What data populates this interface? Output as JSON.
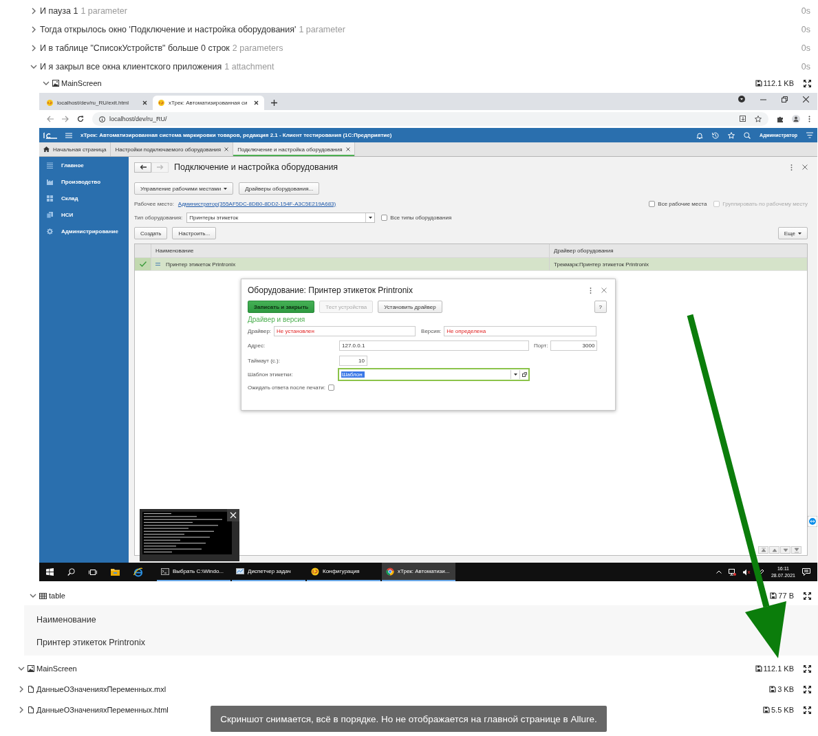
{
  "steps": [
    {
      "text": "И пауза 1",
      "meta": "1 parameter",
      "duration": "0s",
      "expanded": false
    },
    {
      "text": "Тогда открылось окно 'Подключение и настройка оборудования'",
      "meta": "1 parameter",
      "duration": "0s",
      "expanded": false
    },
    {
      "text": "И в таблице \"СписокУстройств\" больше 0 строк",
      "meta": "2 parameters",
      "duration": "0s",
      "expanded": false
    },
    {
      "text": "И я закрыл все окна клиентского приложения",
      "meta": "1 attachment",
      "duration": "0s",
      "expanded": true
    }
  ],
  "screen_attachment": {
    "name": "MainScreen",
    "size": "112.1 KB",
    "expanded": true
  },
  "screenshot": {
    "browser": {
      "tabs": [
        {
          "title": "localhost/dev/ru_RU/exit.html",
          "selected": false
        },
        {
          "title": "xТрек: Автоматизированная си",
          "selected": true
        }
      ],
      "address": "localhost/dev/ru_RU/"
    },
    "app": {
      "title": "xТрек: Автоматизированная система маркировки товаров, редакция 2.1  - Клиент тестирования (1С:Предприятие)",
      "user": "Администратор",
      "tabs": [
        {
          "label": "Начальная страница",
          "selected": false,
          "closable": false
        },
        {
          "label": "Настройки подключаемого оборудования",
          "selected": false,
          "closable": true
        },
        {
          "label": "Подключение и настройка оборудования",
          "selected": true,
          "closable": true
        }
      ],
      "sidebar": [
        {
          "label": "Главное"
        },
        {
          "label": "Производство"
        },
        {
          "label": "Склад"
        },
        {
          "label": "НСИ"
        },
        {
          "label": "Администрирование"
        }
      ],
      "form": {
        "title": "Подключение и настройка оборудования",
        "buttons": [
          {
            "label": "Управление рабочими местами",
            "dropdown": true
          },
          {
            "label": "Драйверы оборудования...",
            "dropdown": false
          }
        ],
        "workplace_label": "Рабочее место:",
        "workplace": "Администратор(355AF5DC-8DB0-8DD2-154F-A3C5E219A683)",
        "filters": [
          {
            "label": "Все рабочие места",
            "checked": false,
            "disabled": false
          },
          {
            "label": "Группировать по рабочему месту",
            "checked": false,
            "disabled": true
          }
        ],
        "type_label": "Тип оборудования:",
        "type_value": "Принтеры этикеток",
        "all_types": {
          "label": "Все типы оборудования",
          "checked": false
        },
        "actions": [
          {
            "label": "Создать"
          },
          {
            "label": "Настроить..."
          }
        ],
        "more": "Еще",
        "table": {
          "columns": [
            "Наименование",
            "Драйвер оборудования"
          ],
          "rows": [
            {
              "cells": [
                "Принтер этикеток Printronix",
                "Трекмарк:Принтер этикеток Printronix"
              ],
              "selected": true,
              "checked": true
            }
          ]
        }
      },
      "dialog": {
        "title": "Оборудование: Принтер этикеток Printronix",
        "buttons": [
          {
            "label": "Записать и закрыть",
            "kind": "primary"
          },
          {
            "label": "Тест устройства",
            "kind": "disabled"
          },
          {
            "label": "Установить драйвер",
            "kind": "normal"
          }
        ],
        "help": "?",
        "section": "Драйвер и версия",
        "driver": {
          "label": "Драйвер:",
          "value": "Не установлен",
          "error": true
        },
        "version": {
          "label": "Версия:",
          "value": "Не определена",
          "error": true
        },
        "address": {
          "label": "Адрес:",
          "value": "127.0.0.1"
        },
        "port": {
          "label": "Порт:",
          "value": "3000"
        },
        "timeout": {
          "label": "Таймаут (с.):",
          "value": "10"
        },
        "template": {
          "label": "Шаблон этикетки:",
          "value": "Шаблон",
          "focused": true
        },
        "wait": {
          "label": "Ожидать ответа после печати:",
          "checked": false
        }
      }
    },
    "taskbar": {
      "items": [
        {
          "label": "Выбрать C:\\Windo...",
          "selected": false
        },
        {
          "label": "Диспетчер задач",
          "selected": false
        },
        {
          "label": "Конфигурация",
          "selected": false
        },
        {
          "label": "xТрек: Автоматизи...",
          "selected": true
        }
      ],
      "time": "16:11",
      "date": "28.07.2021"
    }
  },
  "table_attachment": {
    "name": "table",
    "size": "77 B",
    "expanded": true,
    "columns": [
      "Наименование"
    ],
    "rows": [
      [
        "Принтер этикеток Printronix"
      ]
    ]
  },
  "attachments": [
    {
      "name": "MainScreen",
      "size": "112.1 KB",
      "expanded": true,
      "kind": "image"
    },
    {
      "name": "ДанныеОЗначенияхПеременных.mxl",
      "size": "3 KB",
      "expanded": false,
      "kind": "file"
    },
    {
      "name": "ДанныеОЗначенияхПеременных.html",
      "size": "5.5 KB",
      "expanded": false,
      "kind": "file"
    }
  ],
  "toast": "Скриншот снимается, всё в порядке. Но не отображается на главной странице в Allure."
}
